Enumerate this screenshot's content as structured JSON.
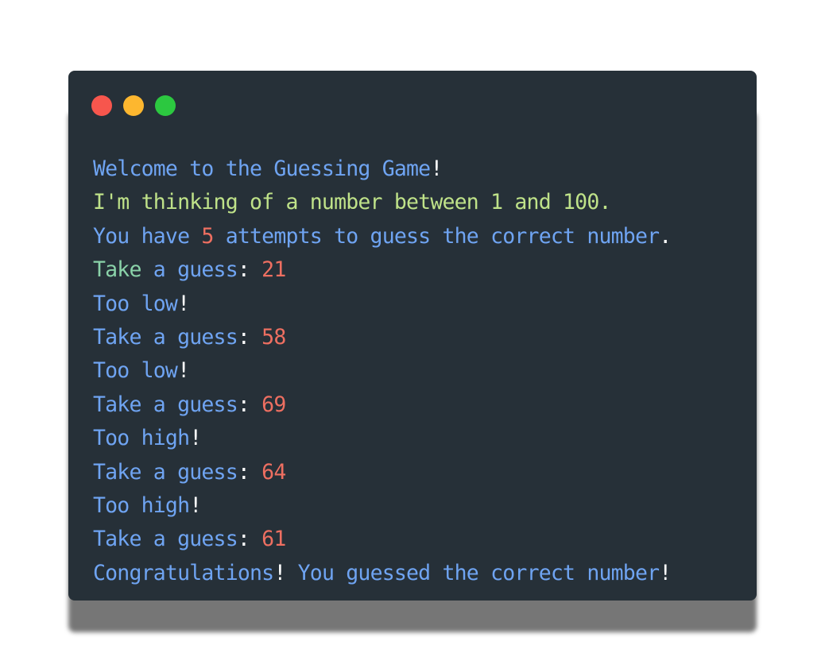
{
  "colors": {
    "close": "#f7564d",
    "minimize": "#fdb72f",
    "maximize": "#2cc840",
    "background": "#263038",
    "text_blue": "#6fa4f2",
    "text_green": "#bfe289",
    "text_teal": "#8ad2a9",
    "number_red": "#ee6f61",
    "punct_white": "#ffffff"
  },
  "window": {
    "controls": [
      "close-icon",
      "minimize-icon",
      "maximize-icon"
    ]
  },
  "lines": [
    {
      "parts": [
        {
          "text": "Welcome to the Guessing Game",
          "cls": ""
        },
        {
          "text": "!",
          "cls": "punct"
        }
      ]
    },
    {
      "parts": [
        {
          "text": "I'm thinking of a number between 1 and 100.",
          "cls": "green"
        }
      ]
    },
    {
      "parts": [
        {
          "text": "You have ",
          "cls": ""
        },
        {
          "text": "5",
          "cls": "num"
        },
        {
          "text": " attempts to guess the correct number",
          "cls": ""
        },
        {
          "text": ".",
          "cls": "punct"
        }
      ]
    },
    {
      "parts": [
        {
          "text": "Take",
          "cls": "teal"
        },
        {
          "text": " a guess",
          "cls": ""
        },
        {
          "text": ":",
          "cls": "punct"
        },
        {
          "text": " 21",
          "cls": "num"
        }
      ]
    },
    {
      "parts": [
        {
          "text": "Too low",
          "cls": ""
        },
        {
          "text": "!",
          "cls": "punct"
        }
      ]
    },
    {
      "parts": [
        {
          "text": "Take a guess",
          "cls": ""
        },
        {
          "text": ":",
          "cls": "punct"
        },
        {
          "text": " 58",
          "cls": "num"
        }
      ]
    },
    {
      "parts": [
        {
          "text": "Too low",
          "cls": ""
        },
        {
          "text": "!",
          "cls": "punct"
        }
      ]
    },
    {
      "parts": [
        {
          "text": "Take a guess",
          "cls": ""
        },
        {
          "text": ":",
          "cls": "punct"
        },
        {
          "text": " 69",
          "cls": "num"
        }
      ]
    },
    {
      "parts": [
        {
          "text": "Too high",
          "cls": ""
        },
        {
          "text": "!",
          "cls": "punct"
        }
      ]
    },
    {
      "parts": [
        {
          "text": "Take a guess",
          "cls": ""
        },
        {
          "text": ":",
          "cls": "punct"
        },
        {
          "text": " 64",
          "cls": "num"
        }
      ]
    },
    {
      "parts": [
        {
          "text": "Too high",
          "cls": ""
        },
        {
          "text": "!",
          "cls": "punct"
        }
      ]
    },
    {
      "parts": [
        {
          "text": "Take a guess",
          "cls": ""
        },
        {
          "text": ":",
          "cls": "punct"
        },
        {
          "text": " 61",
          "cls": "num"
        }
      ]
    },
    {
      "parts": [
        {
          "text": "Congratulations",
          "cls": ""
        },
        {
          "text": "!",
          "cls": "punct"
        },
        {
          "text": " You guessed the correct number",
          "cls": ""
        },
        {
          "text": "!",
          "cls": "punct"
        }
      ]
    }
  ]
}
